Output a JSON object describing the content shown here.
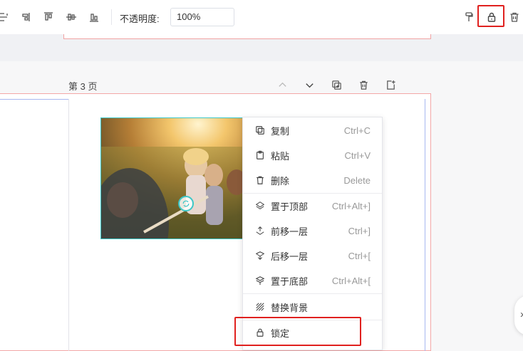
{
  "toolbar": {
    "opacity_label": "不透明度:",
    "opacity_value": "100%",
    "icons": [
      "distribute-horizontal-icon",
      "align-right-icon",
      "align-top-icon",
      "align-middle-icon",
      "align-bottom-icon",
      "format-painter-icon",
      "lock-icon",
      "trash-icon"
    ]
  },
  "page": {
    "title": "第 3 页",
    "tools": [
      "chevron-up-icon",
      "chevron-down-icon",
      "copy-page-icon",
      "trash-icon",
      "add-page-icon"
    ]
  },
  "context_menu": {
    "items": [
      {
        "label": "复制",
        "shortcut": "Ctrl+C",
        "icon": "copy-icon"
      },
      {
        "label": "粘贴",
        "shortcut": "Ctrl+V",
        "icon": "paste-icon"
      },
      {
        "label": "删除",
        "shortcut": "Delete",
        "icon": "trash-icon"
      },
      {
        "label": "置于顶部",
        "shortcut": "Ctrl+Alt+]",
        "icon": "bring-to-front-icon"
      },
      {
        "label": "前移一层",
        "shortcut": "Ctrl+]",
        "icon": "bring-forward-icon"
      },
      {
        "label": "后移一层",
        "shortcut": "Ctrl+[",
        "icon": "send-backward-icon"
      },
      {
        "label": "置于底部",
        "shortcut": "Ctrl+Alt+[",
        "icon": "send-to-back-icon"
      },
      {
        "label": "替换背景",
        "shortcut": "",
        "icon": "hatch-pattern-icon"
      },
      {
        "label": "锁定",
        "shortcut": "",
        "icon": "lock-icon"
      }
    ]
  },
  "colors": {
    "highlight": "#e0211f",
    "selection": "#3cc7c7",
    "canvas_border": "#f3a7a7"
  }
}
